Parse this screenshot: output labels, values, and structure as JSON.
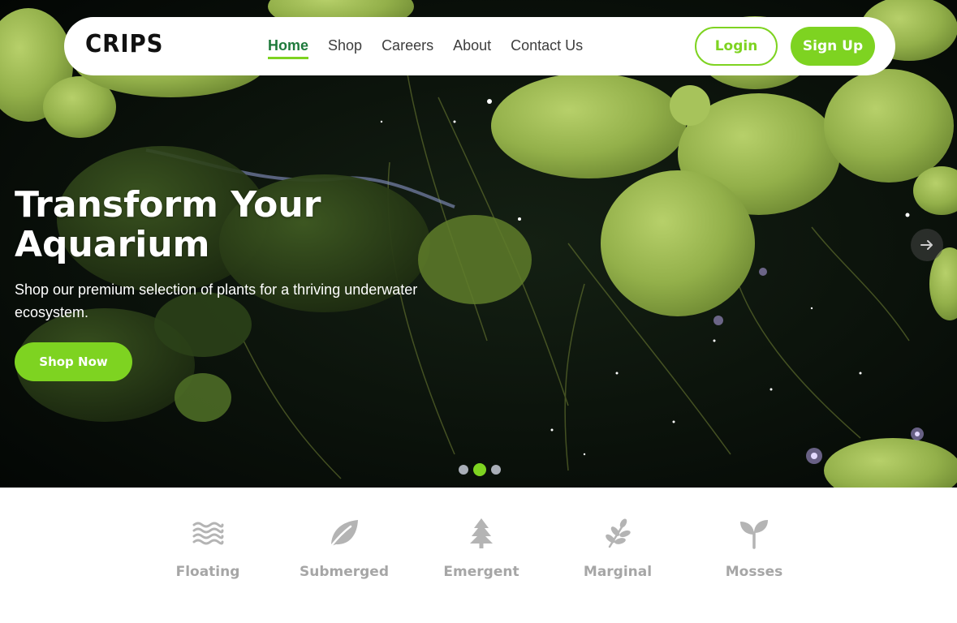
{
  "brand": {
    "logo": "CRIPS"
  },
  "nav": {
    "links": [
      {
        "label": "Home",
        "active": true
      },
      {
        "label": "Shop"
      },
      {
        "label": "Careers"
      },
      {
        "label": "About"
      },
      {
        "label": "Contact Us"
      }
    ],
    "login_label": "Login",
    "signup_label": "Sign Up"
  },
  "hero": {
    "title_line1": "Transform Your",
    "title_line2": "Aquarium",
    "subtitle": "Shop our premium selection of plants for a thriving underwater ecosystem.",
    "cta_label": "Shop Now",
    "next_icon": "arrow-right-icon",
    "slides": {
      "count": 3,
      "active_index": 2
    }
  },
  "categories": [
    {
      "label": "Floating",
      "icon": "water-waves-icon"
    },
    {
      "label": "Submerged",
      "icon": "leaf-icon"
    },
    {
      "label": "Emergent",
      "icon": "pine-tree-icon"
    },
    {
      "label": "Marginal",
      "icon": "herb-sprig-icon"
    },
    {
      "label": "Mosses",
      "icon": "seedling-icon"
    }
  ],
  "colors": {
    "accent": "#7ed321",
    "nav_active": "#1f7a3c",
    "category_text": "#a6a6a6",
    "icon_gray": "#b4b4b4"
  }
}
